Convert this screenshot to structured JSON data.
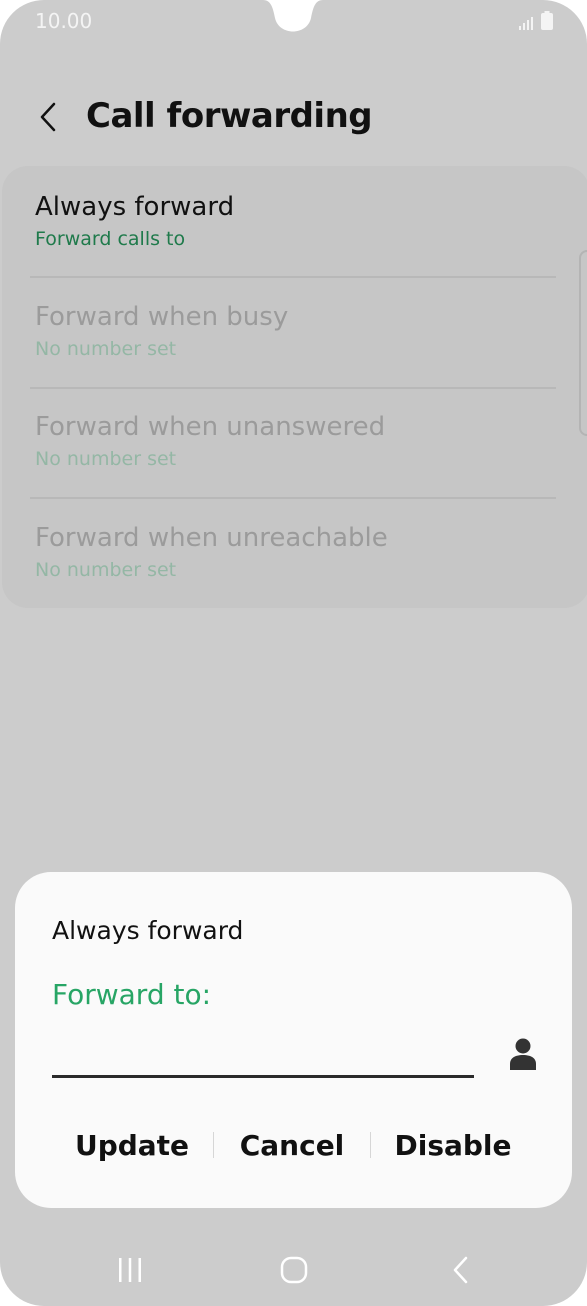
{
  "status_bar": {
    "time": "10.00"
  },
  "header": {
    "title": "Call forwarding"
  },
  "forward_options": [
    {
      "title": "Always forward",
      "subtitle": "Forward calls to",
      "active": true
    },
    {
      "title": "Forward when busy",
      "subtitle": "No number set",
      "active": false
    },
    {
      "title": "Forward when unanswered",
      "subtitle": "No number set",
      "active": false
    },
    {
      "title": "Forward when unreachable",
      "subtitle": "No number set",
      "active": false
    }
  ],
  "dialog": {
    "title": "Always forward",
    "label": "Forward to:",
    "input_value": "",
    "buttons": {
      "update": "Update",
      "cancel": "Cancel",
      "disable": "Disable"
    }
  },
  "colors": {
    "accent_green": "#27a565",
    "subtitle_active": "#1f7a4b",
    "scrim_background": "#cccccc"
  },
  "icons": {
    "back": "back-arrow-icon",
    "contact": "person-icon",
    "signal": "signal-icon",
    "battery": "battery-icon",
    "nav_recents": "recents-icon",
    "nav_home": "home-icon",
    "nav_back": "nav-back-icon"
  }
}
